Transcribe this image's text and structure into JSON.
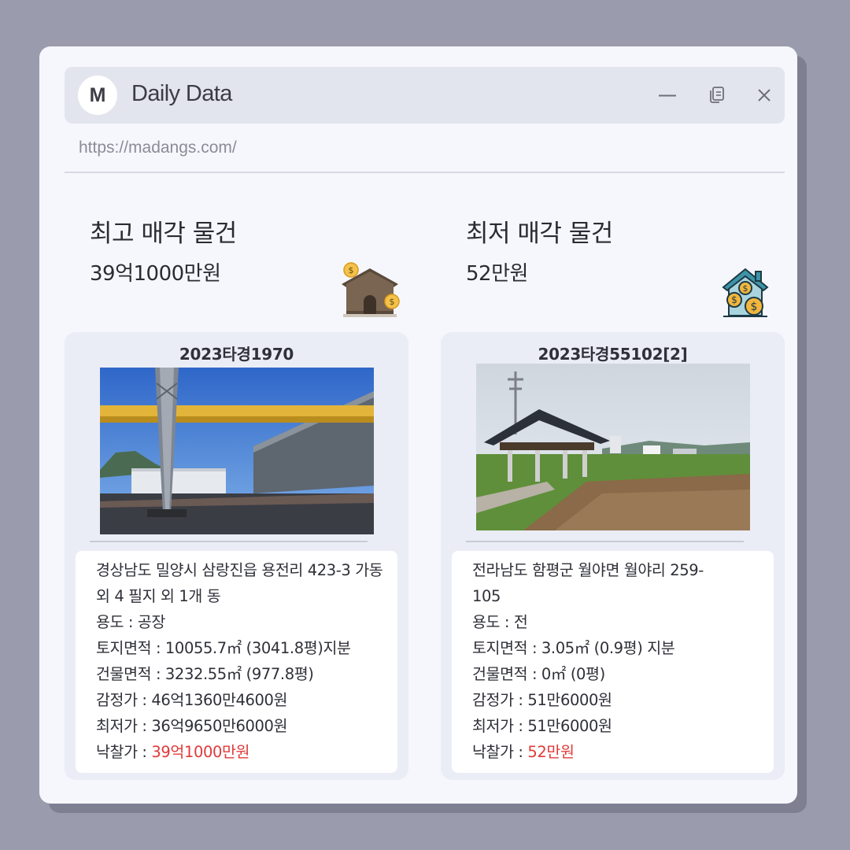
{
  "window": {
    "logo_letter": "M",
    "title": "Daily Data",
    "url": "https://madangs.com/",
    "controls": [
      "minimize-icon",
      "duplicate-icon",
      "close-icon"
    ]
  },
  "highest": {
    "heading": "최고 매각 물건",
    "price": "39억1000만원",
    "icon": "house-money-icon",
    "case_no": "2023타경1970",
    "address": "경상남도 밀양시 삼랑진읍 용전리 423-3 가동 외 4 필지 외 1개 동",
    "usage": "용도 : 공장",
    "land_area": "토지면적 : 10055.7㎡ (3041.8평)지분",
    "building_area": "건물면적 : 3232.55㎡ (977.8평)",
    "appraised": "감정가 : 46억1360만4600원",
    "minimum": "최저가 : 36억9650만6000원",
    "winning_label": "낙찰가 : ",
    "winning_value": "39억1000만원"
  },
  "lowest": {
    "heading": "최저 매각 물건",
    "price": "52만원",
    "icon": "house-coins-icon",
    "case_no": "2023타경55102[2]",
    "address": "전라남도 함평군 월야면 월야리 259-105",
    "usage": "용도 : 전",
    "land_area": "토지면적 : 3.05㎡ (0.9평) 지분",
    "building_area": "건물면적 : 0㎡ (0평)",
    "appraised": "감정가 : 51만6000원",
    "minimum": "최저가 : 51만6000원",
    "winning_label": "낙찰가 : ",
    "winning_value": "52만원"
  },
  "colors": {
    "background": "#9a9cae",
    "window": "#f6f7fc",
    "accent_price": "#e03a3a"
  }
}
